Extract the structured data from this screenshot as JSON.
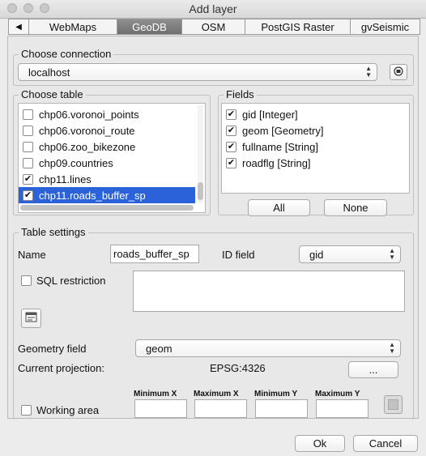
{
  "window": {
    "title": "Add layer"
  },
  "tabs": {
    "items": [
      {
        "label": "WebMaps"
      },
      {
        "label": "GeoDB"
      },
      {
        "label": "OSM"
      },
      {
        "label": "PostGIS Raster"
      },
      {
        "label": "gvSeismic"
      }
    ],
    "active": "GeoDB"
  },
  "connection": {
    "legend": "Choose connection",
    "selected": "localhost"
  },
  "choose_table": {
    "legend": "Choose table",
    "items": [
      {
        "label": "chp06.voronoi_points",
        "checked": false,
        "selected": false
      },
      {
        "label": "chp06.voronoi_route",
        "checked": false,
        "selected": false
      },
      {
        "label": "chp06.zoo_bikezone",
        "checked": false,
        "selected": false
      },
      {
        "label": "chp09.countries",
        "checked": false,
        "selected": false
      },
      {
        "label": "chp11.lines",
        "checked": true,
        "selected": false
      },
      {
        "label": "chp11.roads_buffer_sp",
        "checked": true,
        "selected": true
      }
    ]
  },
  "fields": {
    "legend": "Fields",
    "items": [
      {
        "label": "gid [Integer]",
        "checked": true
      },
      {
        "label": "geom [Geometry]",
        "checked": true
      },
      {
        "label": "fullname [String]",
        "checked": true
      },
      {
        "label": "roadflg [String]",
        "checked": true
      }
    ],
    "all_label": "All",
    "none_label": "None"
  },
  "table_settings": {
    "legend": "Table settings",
    "name_label": "Name",
    "name_value": "roads_buffer_sp",
    "id_field_label": "ID field",
    "id_field_value": "gid",
    "sql_label": "SQL restriction",
    "sql_value": "",
    "geometry_field_label": "Geometry field",
    "geometry_field_value": "geom",
    "projection_label": "Current projection:",
    "projection_value": "EPSG:4326",
    "projection_button": "...",
    "working_area_label": "Working area",
    "min_x_label": "Minimum X",
    "max_x_label": "Maximum X",
    "min_y_label": "Minimum Y",
    "max_y_label": "Maximum Y"
  },
  "footer": {
    "ok_label": "Ok",
    "cancel_label": "Cancel"
  },
  "icons": {
    "check": "✔",
    "left_arrow": "◀",
    "right_arrow": "▶",
    "combo_arrows": "updown-icon"
  }
}
